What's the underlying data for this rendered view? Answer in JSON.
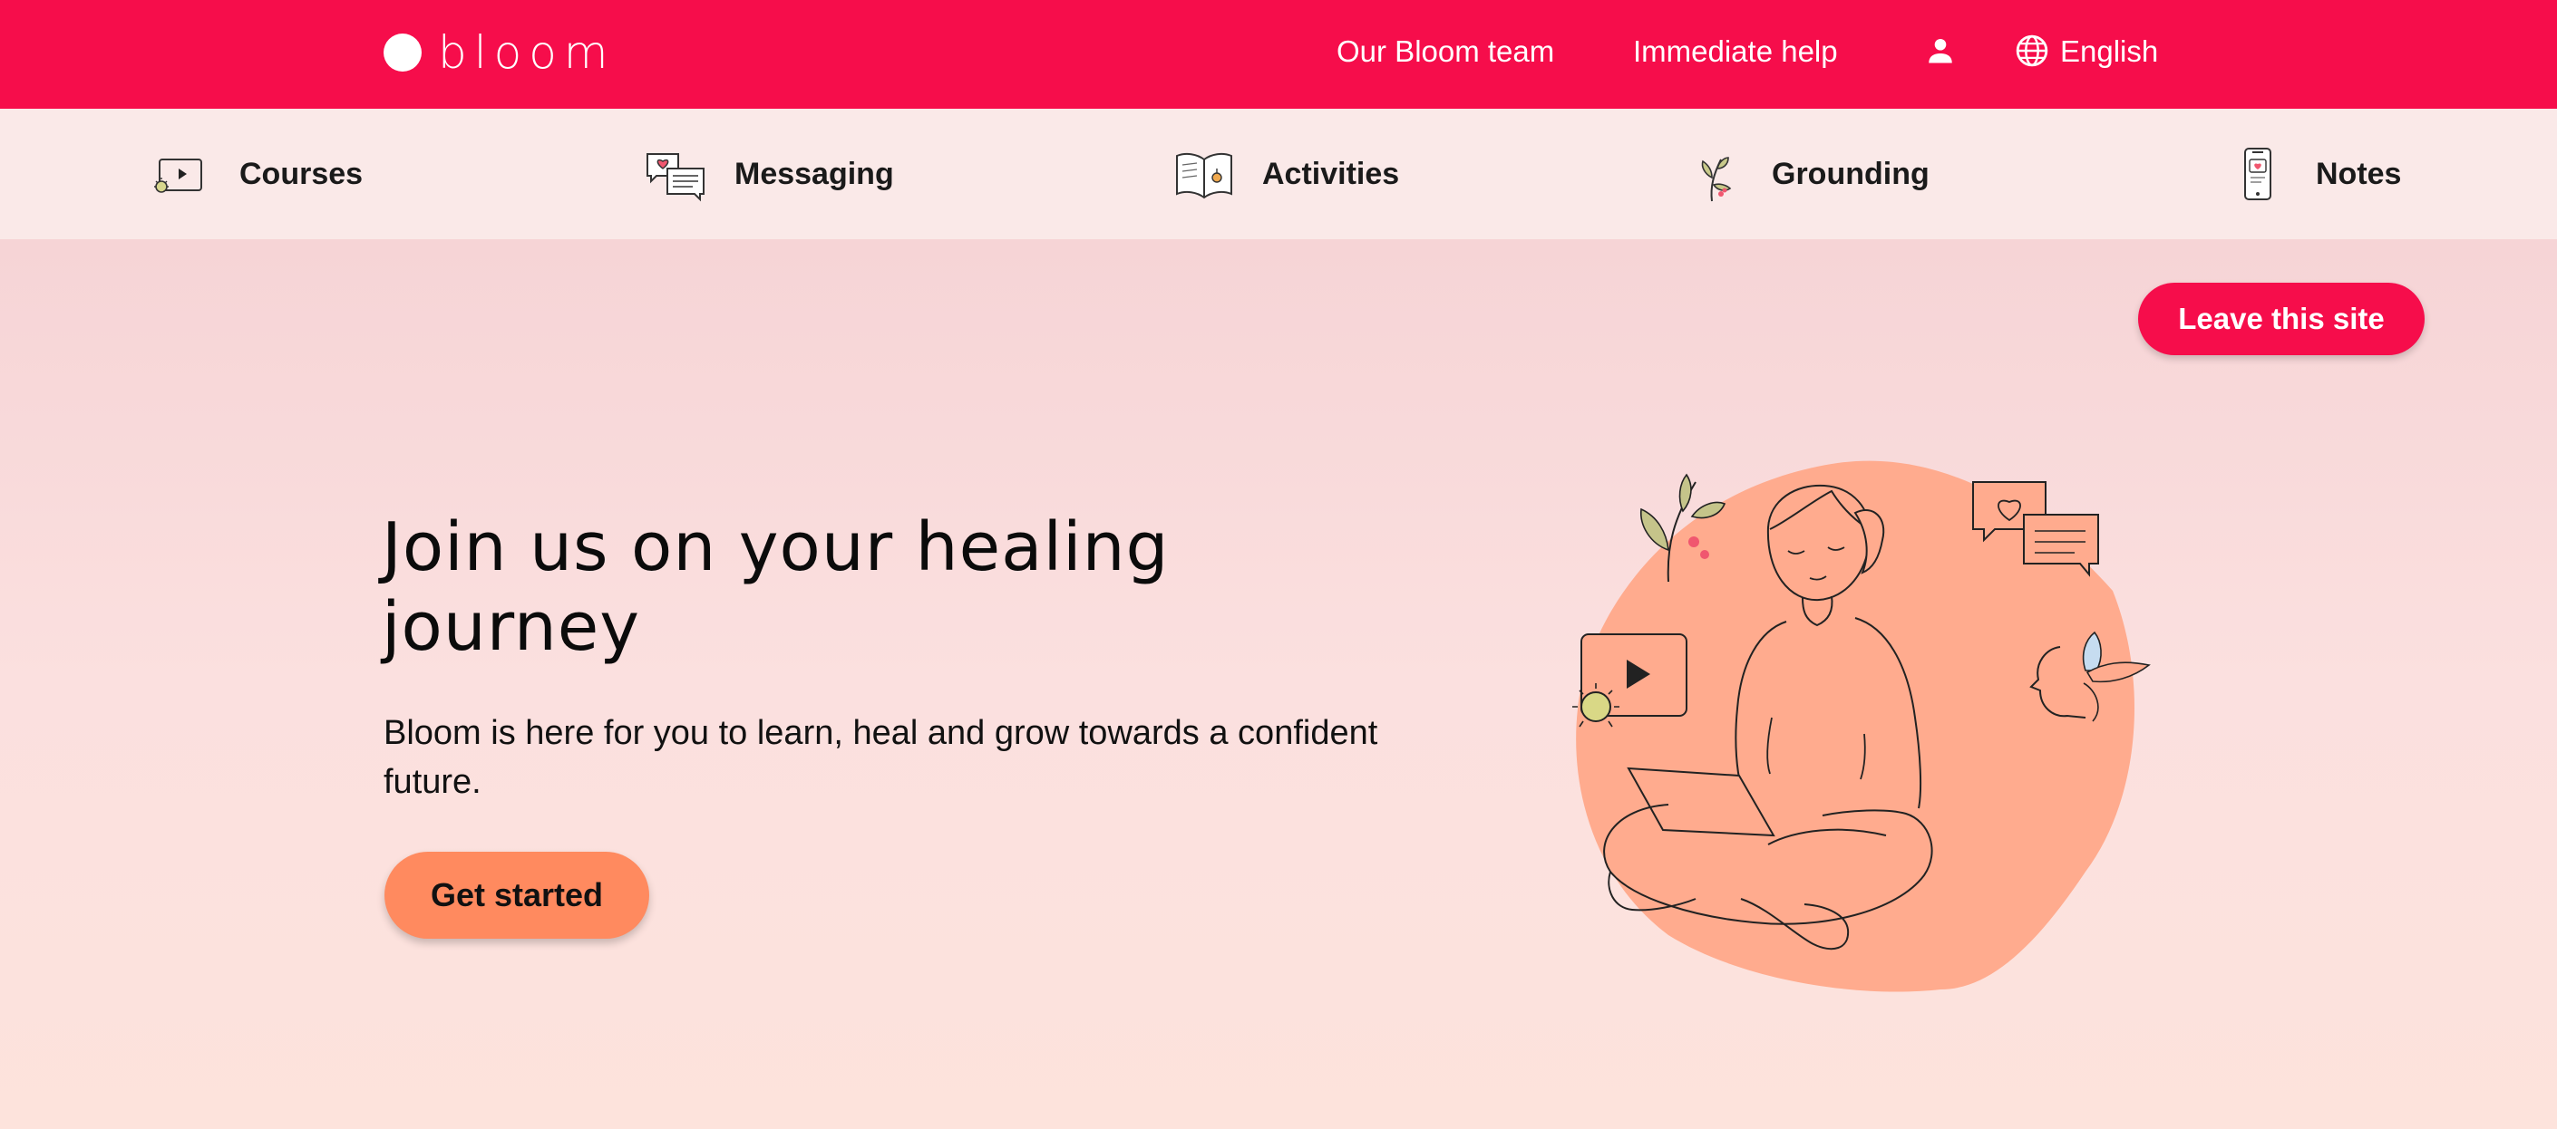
{
  "colors": {
    "brand_red": "#f60d4b",
    "subnav_bg": "#fae9e8",
    "cta_orange": "#ff8a5f",
    "blob_peach": "#ffab8e"
  },
  "header": {
    "logo_text": "bloom",
    "links": {
      "team": "Our Bloom team",
      "help": "Immediate help",
      "language": "English"
    },
    "icons": [
      "user-icon",
      "globe-icon"
    ]
  },
  "subnav": {
    "items": [
      {
        "label": "Courses",
        "icon": "video-course-icon"
      },
      {
        "label": "Messaging",
        "icon": "chat-bubbles-icon"
      },
      {
        "label": "Activities",
        "icon": "open-book-icon"
      },
      {
        "label": "Grounding",
        "icon": "plant-sprig-icon"
      },
      {
        "label": "Notes",
        "icon": "phone-heart-icon"
      }
    ]
  },
  "hero": {
    "leave_button": "Leave this site",
    "title": "Join us on your healing journey",
    "description": "Bloom is here for you to learn, heal and grow towards a confident future.",
    "cta": "Get started",
    "illustration": "person-with-laptop-illustration"
  }
}
